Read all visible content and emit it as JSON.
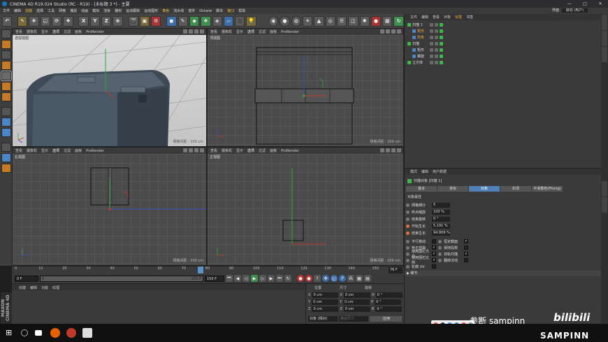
{
  "window": {
    "title": "CINEMA 4D R19.024 Studio (RC - R19) - [未标题 3 *] - 主要",
    "controls": [
      "—",
      "□",
      "✕"
    ]
  },
  "menu": {
    "items": [
      "文件",
      "编辑",
      "创建",
      "选择",
      "工具",
      "网格",
      "捕捉",
      "动画",
      "模拟",
      "渲染",
      "雕刻",
      "运动跟踪",
      "运动图形",
      "角色",
      "流水线",
      "插件",
      "Octane",
      "脚本",
      "窗口",
      "帮助"
    ],
    "highlighted": [
      2,
      13,
      18
    ],
    "right_label": "界面",
    "right_value": "启动 (用户)"
  },
  "toolbar": {
    "xyz": [
      "X",
      "Y",
      "Z"
    ]
  },
  "viewports": [
    {
      "menu": [
        "查看",
        "摄像机",
        "显示",
        "选项",
        "过滤",
        "面板",
        "ProRender"
      ],
      "name": "透视视图",
      "distance": ""
    },
    {
      "menu": [
        "查看",
        "摄像机",
        "显示",
        "选项",
        "过滤",
        "面板",
        "ProRender"
      ],
      "name": "顶视图",
      "distance": "网格间距 : 100 cm"
    },
    {
      "menu": [
        "查看",
        "摄像机",
        "显示",
        "选项",
        "过滤",
        "面板",
        "ProRender"
      ],
      "name": "右视图",
      "distance": "网格间距 : 100 cm"
    },
    {
      "menu": [
        "查看",
        "摄像机",
        "显示",
        "选项",
        "过滤",
        "面板",
        "ProRender"
      ],
      "name": "正视图",
      "distance": "网格间距 : 100 cm"
    }
  ],
  "perspective_distance": "网格间距 : 100 cm",
  "timeline": {
    "ticks": [
      "0",
      "10",
      "20",
      "30",
      "40",
      "50",
      "60",
      "70",
      "80",
      "90",
      "100",
      "110",
      "120",
      "130",
      "140",
      "150"
    ],
    "current_frame": "76 F",
    "playhead_label": "76"
  },
  "transport": {
    "start": "0 F",
    "start_value": "0",
    "end": "150 F",
    "end_field": "150 F"
  },
  "materials": {
    "menu": [
      "创建",
      "编辑",
      "功能",
      "纹理"
    ]
  },
  "coords": {
    "headers": [
      "位置",
      "尺寸",
      "旋转"
    ],
    "rows": [
      {
        "axis": "X",
        "pos": "0 cm",
        "size_axis": "X",
        "size": "0 cm",
        "rot_axis": "H",
        "rot": "0 °"
      },
      {
        "axis": "Y",
        "pos": "0 cm",
        "size_axis": "Y",
        "size": "0 cm",
        "rot_axis": "P",
        "rot": "0 °"
      },
      {
        "axis": "Z",
        "pos": "0 cm",
        "size_axis": "Z",
        "size": "0 cm",
        "rot_axis": "B",
        "rot": "0 °"
      }
    ],
    "mode1": "对象 (相对)",
    "mode2": "绝对尺寸",
    "apply": "应用"
  },
  "objects": {
    "menu": [
      "文件",
      "编辑",
      "查看",
      "对象",
      "标签",
      "书签"
    ],
    "highlighted": [
      4
    ],
    "rows": [
      {
        "name": "扫描 1",
        "indent": 0,
        "selected": false
      },
      {
        "name": "矩形",
        "indent": 1,
        "selected": true
      },
      {
        "name": "样条",
        "indent": 1,
        "selected": true
      },
      {
        "name": "扫描",
        "indent": 0,
        "selected": false
      },
      {
        "name": "矩形",
        "indent": 1,
        "selected": false
      },
      {
        "name": "螺旋",
        "indent": 1,
        "selected": false
      },
      {
        "name": "立方体",
        "indent": 0,
        "selected": false
      }
    ]
  },
  "attributes": {
    "menu": [
      "模式",
      "编辑",
      "用户数据"
    ],
    "object_title": "扫描对象 [扫描 1]",
    "tabs": [
      "基本",
      "坐标",
      "对象",
      "封顶",
      "平滑着色(Phong)"
    ],
    "active_tab": 2,
    "section": "对象属性",
    "fields": [
      {
        "label": "网格细分",
        "value": "5",
        "orange": false
      },
      {
        "label": "终点缩放",
        "value": "100 %",
        "orange": false
      },
      {
        "label": "结束旋转",
        "value": "0 °",
        "orange": false
      },
      {
        "label": "开始生长",
        "value": "5.191 %",
        "orange": true
      },
      {
        "label": "结束生长",
        "value": "94.809 %",
        "orange": true
      }
    ],
    "checks_left": [
      {
        "label": "平行移动",
        "checked": false
      },
      {
        "label": "矫正扭曲",
        "checked": true
      },
      {
        "label": "使用围栏方向",
        "checked": true
      },
      {
        "label": "使用围栏比例",
        "checked": true
      },
      {
        "label": "轮廓 UV",
        "checked": false
      }
    ],
    "checks_right": [
      {
        "label": "恒定截面",
        "checked": true
      },
      {
        "label": "保持段数",
        "checked": false
      },
      {
        "label": "双轨扫描",
        "checked": true
      },
      {
        "label": "翻转法线",
        "checked": false
      }
    ],
    "detail": "▶ 细节"
  },
  "overlay": {
    "text": "参断 sampinn",
    "brand1": "bilibili",
    "brand2": "SAMPINN"
  },
  "c4d_logo": "MAXON CINEMA 4D"
}
